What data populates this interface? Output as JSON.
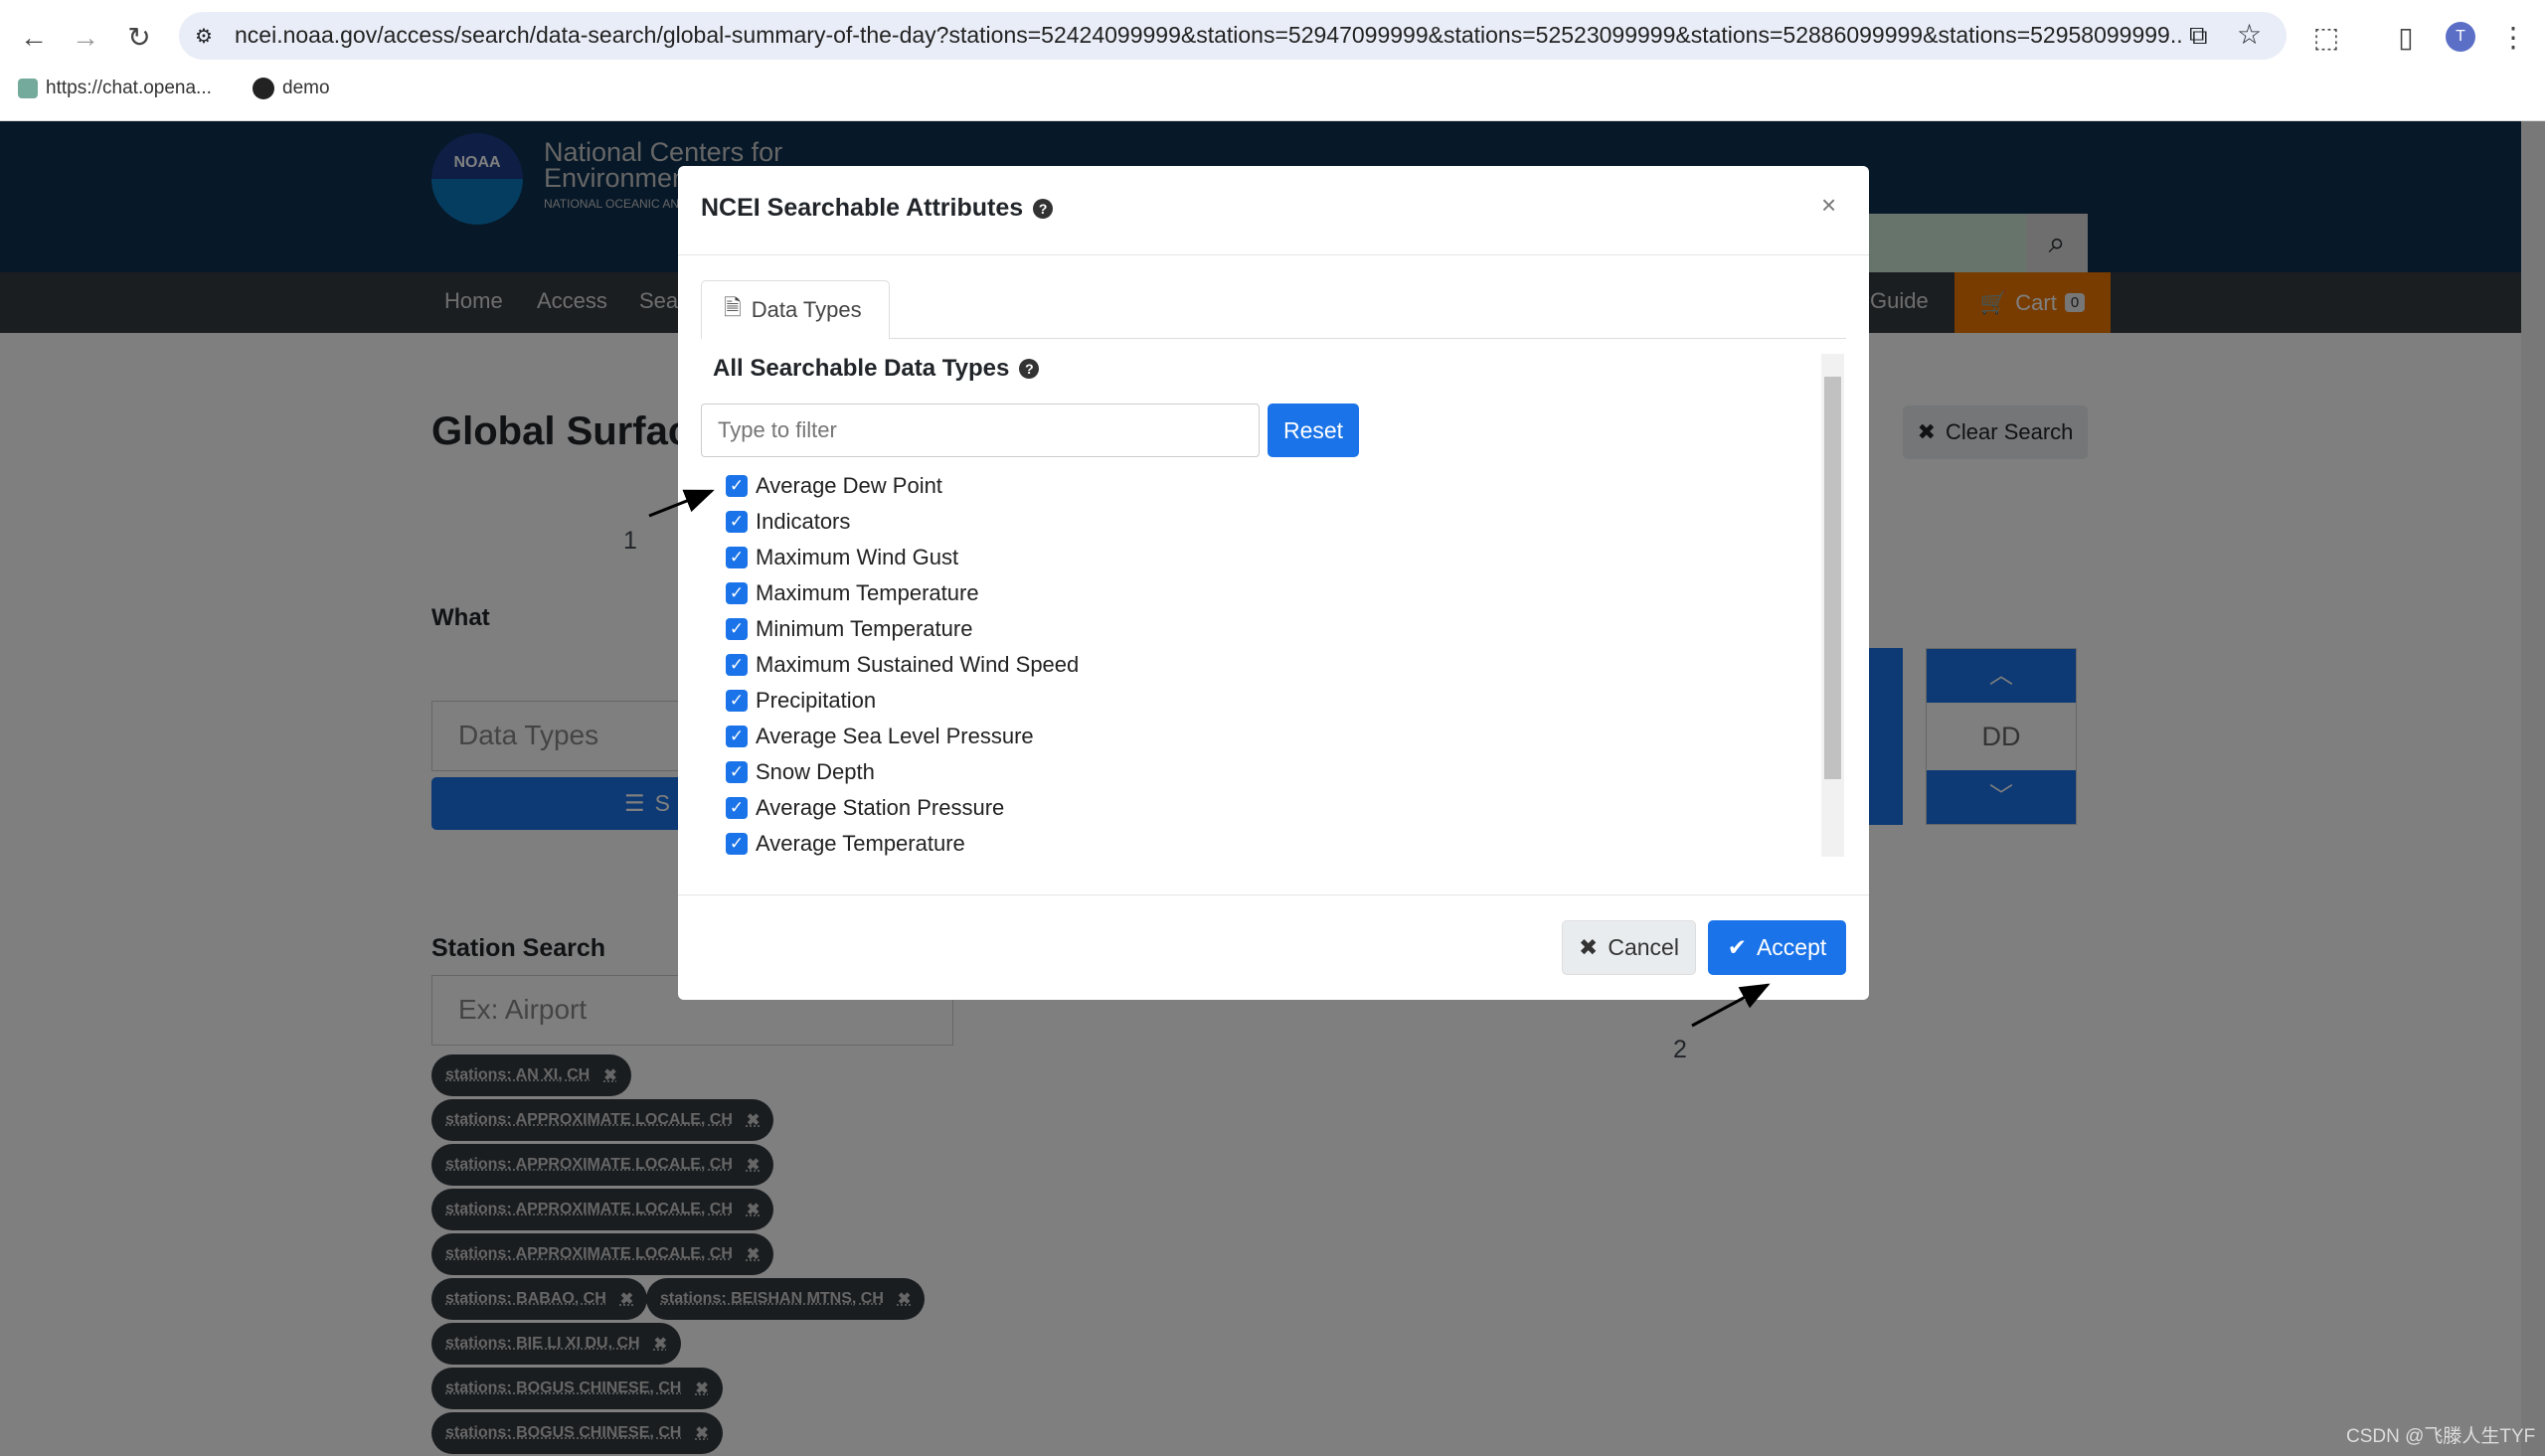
{
  "browser": {
    "url": "ncei.noaa.gov/access/search/data-search/global-summary-of-the-day?stations=52424099999&stations=52947099999&stations=52523099999&stations=52886099999&stations=52958099999...",
    "bookmarks": [
      "https://chat.opena...",
      "demo"
    ],
    "profile_initial": "T"
  },
  "header": {
    "org_line1": "National Centers for",
    "org_line2": "Environmen",
    "org_line3": "NATIONAL OCEANIC AND",
    "logo_text": "NOAA"
  },
  "nav": {
    "breadcrumbs": [
      "Home",
      "Access",
      "Sea"
    ],
    "guide": "Guide",
    "cart": "Cart",
    "cart_count": "0"
  },
  "background": {
    "title": "Global Surfac",
    "clear_search": "Clear Search",
    "what_label": "What",
    "data_types_placeholder": "Data Types",
    "select_btn": "S",
    "dd_label": "DD",
    "station_search_label": "Station Search",
    "station_placeholder": "Ex: Airport",
    "chips": [
      "stations: AN XI, CH",
      "stations: APPROXIMATE LOCALE, CH",
      "stations: APPROXIMATE LOCALE, CH",
      "stations: APPROXIMATE LOCALE, CH",
      "stations: APPROXIMATE LOCALE, CH",
      "stations: BABAO, CH",
      "stations: BEISHAN MTNS, CH",
      "stations: BIE LI XI DU, CH",
      "stations: BOGUS CHINESE, CH",
      "stations: BOGUS CHINESE, CH"
    ]
  },
  "modal": {
    "title": "NCEI Searchable Attributes",
    "tab": "Data Types",
    "section_title": "All Searchable Data Types",
    "filter_placeholder": "Type to filter",
    "reset": "Reset",
    "cancel": "Cancel",
    "accept": "Accept",
    "items": [
      {
        "label": "Average Dew Point",
        "checked": true
      },
      {
        "label": "Indicators",
        "checked": true
      },
      {
        "label": "Maximum Wind Gust",
        "checked": true
      },
      {
        "label": "Maximum Temperature",
        "checked": true
      },
      {
        "label": "Minimum Temperature",
        "checked": true
      },
      {
        "label": "Maximum Sustained Wind Speed",
        "checked": true
      },
      {
        "label": "Precipitation",
        "checked": true
      },
      {
        "label": "Average Sea Level Pressure",
        "checked": true
      },
      {
        "label": "Snow Depth",
        "checked": true
      },
      {
        "label": "Average Station Pressure",
        "checked": true
      },
      {
        "label": "Average Temperature",
        "checked": true
      }
    ]
  },
  "annotations": [
    "1",
    "2"
  ],
  "watermark": "CSDN @飞滕人生TYF",
  "colors": {
    "accent": "#1a73e8",
    "header": "#0e3050",
    "cart": "#f07800"
  }
}
